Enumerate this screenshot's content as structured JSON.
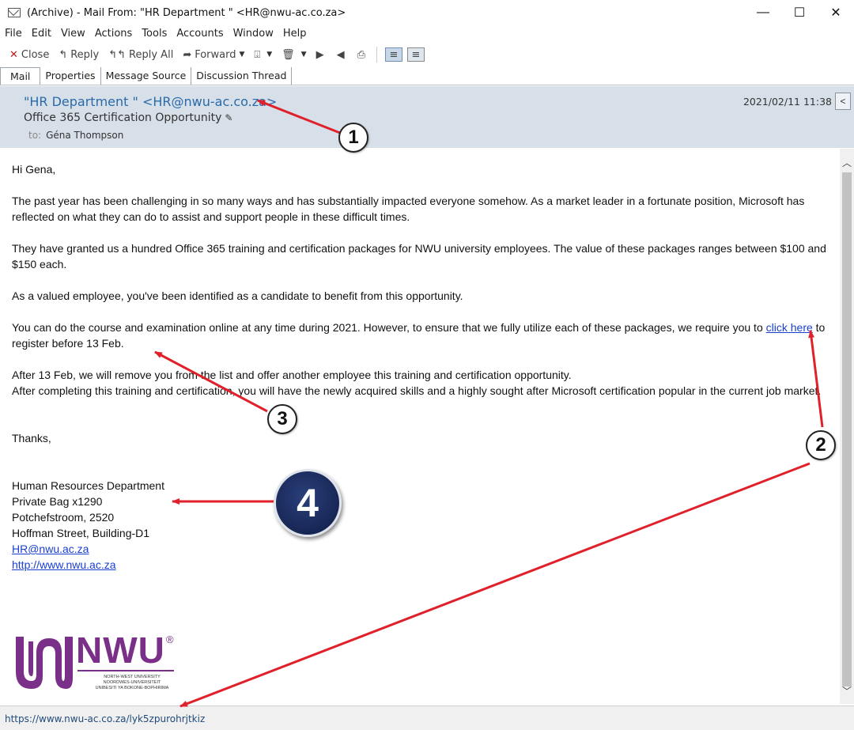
{
  "window": {
    "title": "(Archive) - Mail From: \"HR Department \" <HR@nwu-ac.co.za>",
    "minimize": "—",
    "maximize": "☐",
    "close": "✕"
  },
  "menu": [
    "File",
    "Edit",
    "View",
    "Actions",
    "Tools",
    "Accounts",
    "Window",
    "Help"
  ],
  "toolbar": {
    "close_label": "Close",
    "reply_label": "Reply",
    "reply_all_label": "Reply All",
    "forward_label": "Forward"
  },
  "tabs": [
    "Mail",
    "Properties",
    "Message Source",
    "Discussion Thread"
  ],
  "header": {
    "from": "\"HR Department \" <HR@nwu-ac.co.za>",
    "subject": "Office 365 Certification Opportunity",
    "to_label": "to:",
    "to_name": "Géna Thompson",
    "date": "2021/02/11 11:38"
  },
  "body": {
    "greeting": "Hi Gena,",
    "p1": "The past year has been challenging in so many ways and has substantially impacted everyone somehow. As a market leader in a fortunate position, Microsoft has reflected on what they can do to assist and support people in these difficult times.",
    "p2": "They have granted us a hundred Office 365 training and certification packages for NWU university employees. The value of these packages ranges between $100 and $150 each.",
    "p3": "As a valued employee, you've been identified as a candidate to benefit from this opportunity.",
    "p4_before": "You can do the course and examination online at any time during 2021. However, to ensure that we fully utilize each of these packages, we require you to ",
    "p4_link": "click here",
    "p4_after": " to register before 13 Feb.",
    "p5_line1": "After 13 Feb, we will remove you from the list and offer another employee this training and certification opportunity.",
    "p5_line2": "After completing this training and certification, you will have the newly acquired skills and a highly sought after Microsoft certification popular in the current job market.",
    "thanks": "Thanks,",
    "signature": {
      "line1": "Human Resources Department",
      "line2": "Private Bag x1290",
      "line3": "Potchefstroom, 2520",
      "line4": "Hoffman Street, Building-D1",
      "email": "HR@nwu.ac.za",
      "website": "http://www.nwu.ac.za"
    }
  },
  "logo": {
    "text": "NWU",
    "reg": "®",
    "line1": "NORTH-WEST UNIVERSITY",
    "line2": "NOORDWES-UNIVERSITEIT",
    "line3": "UNIBESITI YA BOKONE-BOPHIRIMA"
  },
  "status_bar": {
    "url": "https://www.nwu-ac.co.za/lyk5zpurohrjtkiz"
  },
  "annotations": {
    "badge1": "1",
    "badge2": "2",
    "badge3": "3",
    "badge4": "4",
    "arrow_color": "#e0202a"
  }
}
